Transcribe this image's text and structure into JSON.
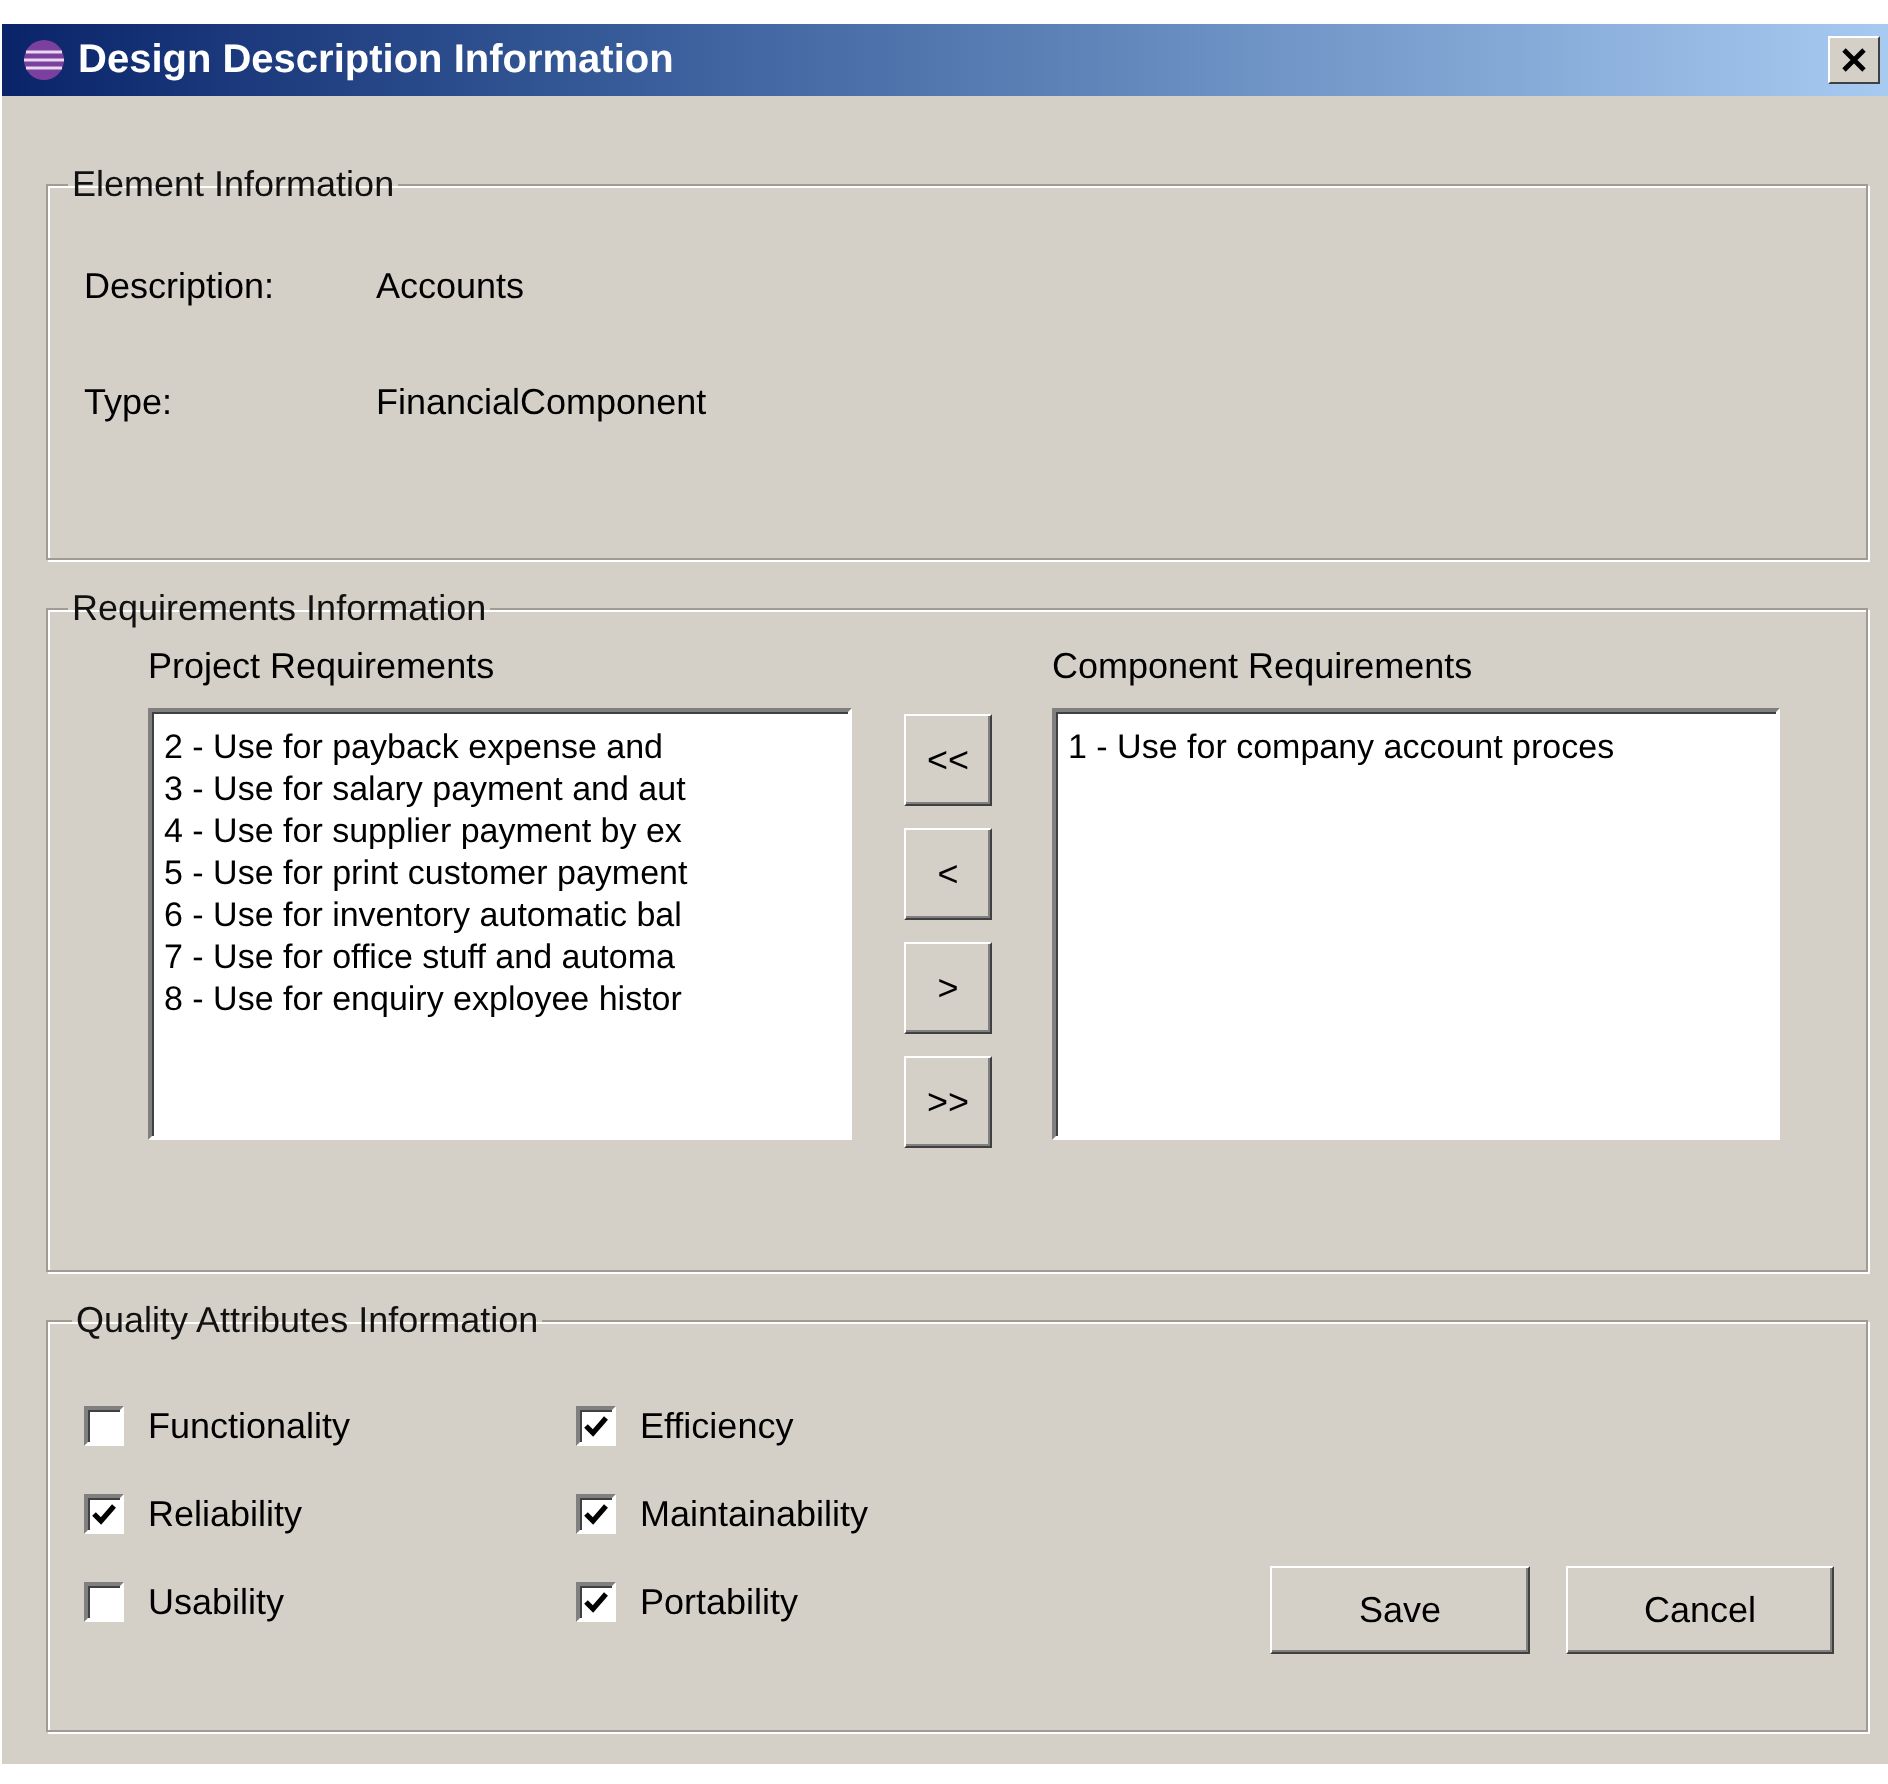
{
  "window": {
    "title": "Design Description Information"
  },
  "element_information": {
    "title": "Element Information",
    "fields": [
      {
        "label": "Description:",
        "value": "Accounts"
      },
      {
        "label": "Type:",
        "value": "FinancialComponent"
      }
    ]
  },
  "requirements_information": {
    "title": "Requirements Information",
    "project_requirements": {
      "title": "Project Requirements",
      "items": [
        "2 - Use for payback expense and",
        "3 - Use for salary payment and aut",
        "4 - Use for supplier payment by ex",
        "5 - Use for print customer payment",
        "6 - Use for inventory automatic bal",
        "7 - Use for office stuff and automa",
        "8 - Use for enquiry exployee histor"
      ]
    },
    "move_buttons": [
      "<<",
      "<",
      ">",
      ">>"
    ],
    "component_requirements": {
      "title": "Component Requirements",
      "items": [
        "1 - Use for company account proces"
      ]
    }
  },
  "quality_attributes_information": {
    "title": "Quality Attributes Information",
    "attributes": [
      {
        "label": "Functionality",
        "checked": false
      },
      {
        "label": "Reliability",
        "checked": true
      },
      {
        "label": "Usability",
        "checked": false
      },
      {
        "label": "Efficiency",
        "checked": true
      },
      {
        "label": "Maintainability",
        "checked": true
      },
      {
        "label": "Portability",
        "checked": true
      }
    ]
  },
  "buttons": [
    "Save",
    "Cancel"
  ]
}
